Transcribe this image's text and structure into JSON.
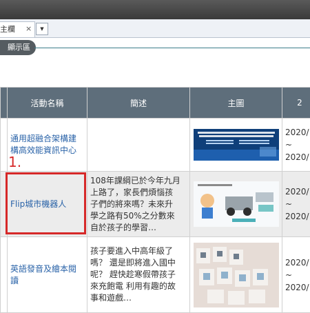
{
  "tabs": {
    "active_label": "主欄",
    "close_glyph": "×",
    "dropdown_glyph": "▼"
  },
  "section": {
    "label": "顯示區"
  },
  "table": {
    "headers": [
      "活動名稱",
      "簡述",
      "主圖",
      "2"
    ],
    "rows": [
      {
        "name": "通用超融合架構建構高效能資訊中心",
        "name_lines": [
          "通用超融合架構建",
          "構高效能資訊中心"
        ],
        "summary_lines": [],
        "date_lines": [
          "2020/",
          "~",
          "2020/"
        ],
        "image": "banner-slide"
      },
      {
        "name": "Flip城市機器人",
        "name_lines": [
          "Flip城市機器人"
        ],
        "summary_lines": [
          "108年課綱已於今年九月",
          "上路了，家長們煩惱孩",
          "子們的將來嗎？未來升",
          "學之路有50%之分數來",
          "自於孩子的學習…"
        ],
        "date_lines": [
          "2020/",
          "~",
          "2020/"
        ],
        "image": "robot-kit"
      },
      {
        "name": "英語發音及繪本閱讀",
        "name_lines": [
          "英語發音及繪本閱",
          "讀"
        ],
        "summary_lines": [
          "孩子要進入中高年級了",
          "嗎？ 還是即將進入國中",
          "呢？ 趕快趁寒假帶孩子",
          "來充飽電 利用有趣的故",
          "事和遊戲…"
        ],
        "date_lines": [
          "2020/",
          "~",
          "2020/"
        ],
        "image": "alphabet-cards"
      }
    ]
  },
  "annotation": {
    "step": "1."
  },
  "colors": {
    "header_bg": "#5e6e7b",
    "link": "#2a63a8",
    "highlight": "#d62828",
    "pill_bg": "#555c61"
  }
}
